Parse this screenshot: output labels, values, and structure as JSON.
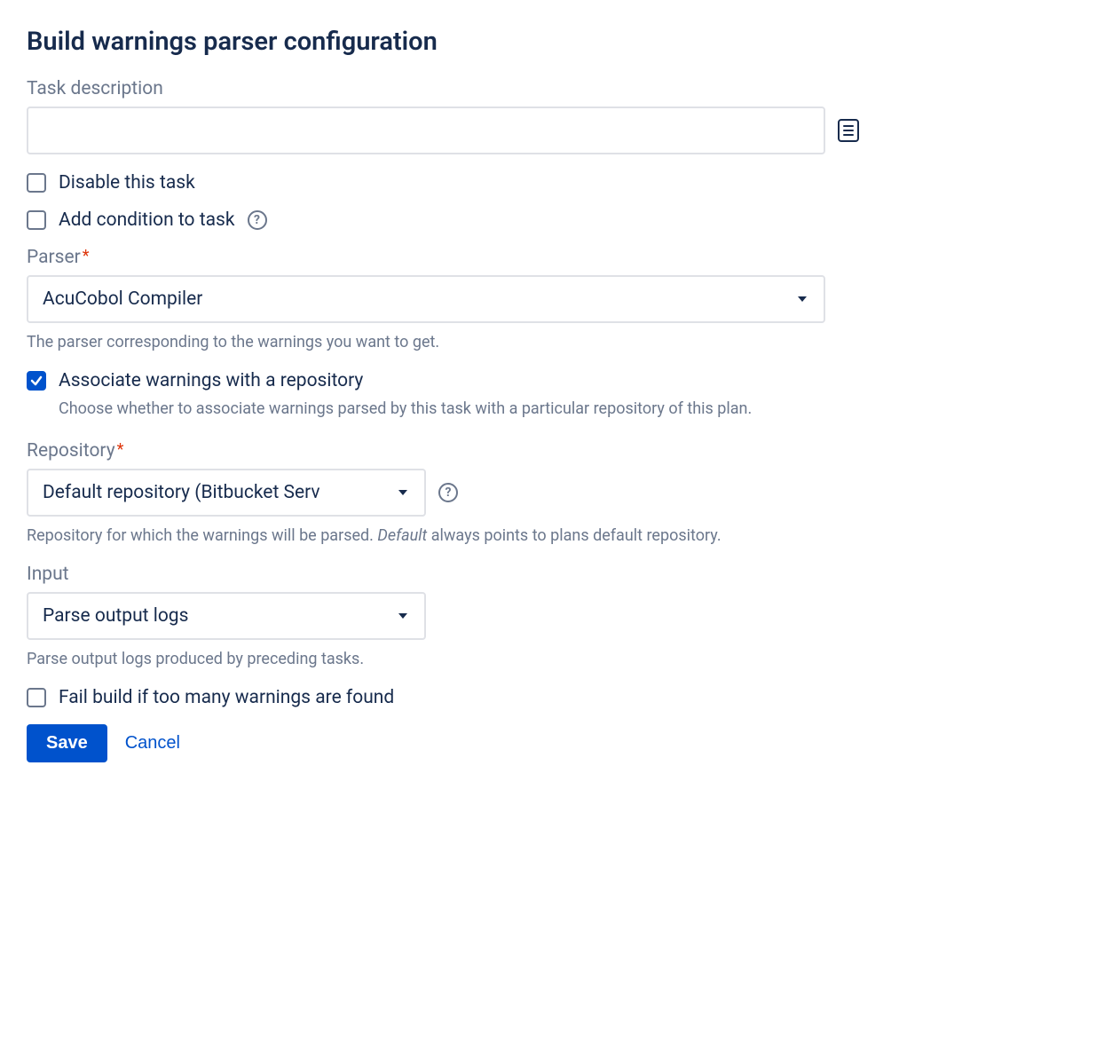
{
  "page_title": "Build warnings parser configuration",
  "task_description": {
    "label": "Task description",
    "value": ""
  },
  "disable_task": {
    "label": "Disable this task",
    "checked": false
  },
  "add_condition": {
    "label": "Add condition to task",
    "checked": false
  },
  "parser": {
    "label": "Parser",
    "value": "AcuCobol Compiler",
    "help": "The parser corresponding to the warnings you want to get."
  },
  "associate": {
    "label": "Associate warnings with a repository",
    "checked": true,
    "help": "Choose whether to associate warnings parsed by this task with a particular repository of this plan."
  },
  "repository": {
    "label": "Repository",
    "value": "Default repository (Bitbucket Serv",
    "help_pre": "Repository for which the warnings will be parsed. ",
    "help_italic": "Default",
    "help_post": " always points to plans default repository."
  },
  "input": {
    "label": "Input",
    "value": "Parse output logs",
    "help": "Parse output logs produced by preceding tasks."
  },
  "fail_build": {
    "label": "Fail build if too many warnings are found",
    "checked": false
  },
  "buttons": {
    "save": "Save",
    "cancel": "Cancel"
  }
}
